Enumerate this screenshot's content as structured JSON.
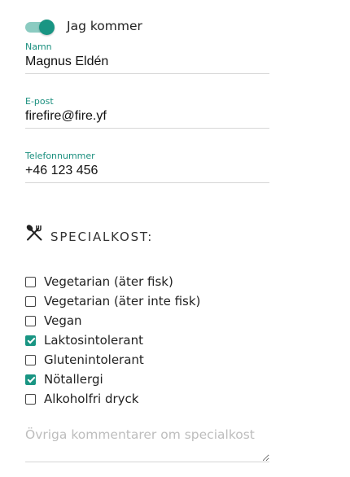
{
  "attending": {
    "label": "Jag kommer",
    "on": true
  },
  "fields": {
    "name": {
      "label": "Namn",
      "value": "Magnus Eldén"
    },
    "email": {
      "label": "E-post",
      "value": "firefire@fire.yf"
    },
    "phone": {
      "label": "Telefonnummer",
      "value": "+46 123 456"
    }
  },
  "special_diet": {
    "icon": "utensils-icon",
    "heading": "SPECIALKOST:",
    "options": [
      {
        "label": "Vegetarian (äter fisk)",
        "checked": false
      },
      {
        "label": "Vegetarian (äter inte fisk)",
        "checked": false
      },
      {
        "label": "Vegan",
        "checked": false
      },
      {
        "label": "Laktosintolerant",
        "checked": true
      },
      {
        "label": "Glutenintolerant",
        "checked": false
      },
      {
        "label": "Nötallergi",
        "checked": true
      },
      {
        "label": "Alkoholfri dryck",
        "checked": false
      }
    ],
    "comment_placeholder": "Övriga kommentarer om specialkost"
  },
  "colors": {
    "accent": "#199583",
    "accent_light": "#8bcbc1",
    "label": "#1a8f7e"
  }
}
